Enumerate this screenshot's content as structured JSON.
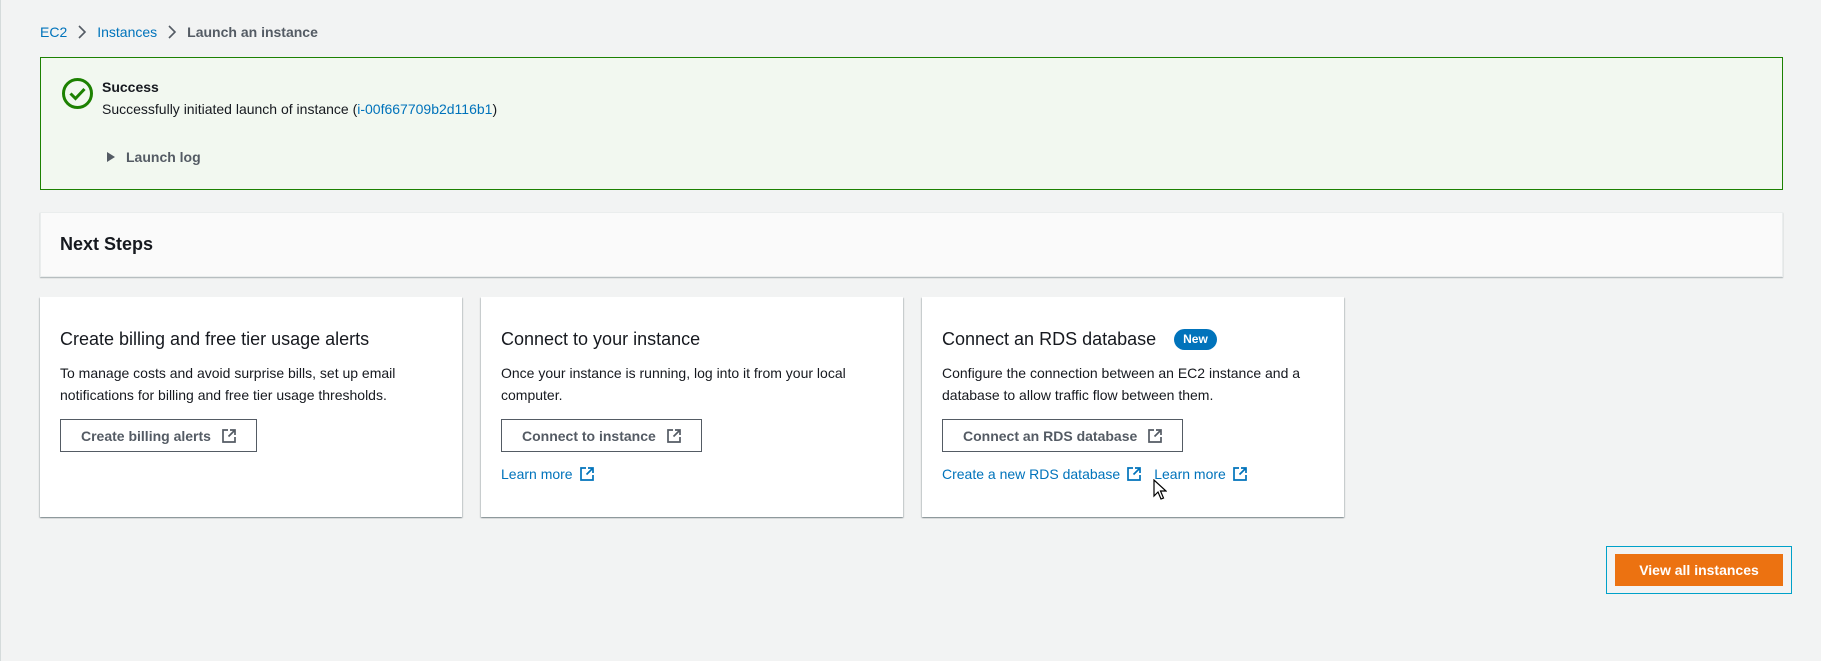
{
  "breadcrumb": {
    "items": [
      "EC2",
      "Instances"
    ],
    "current": "Launch an instance"
  },
  "flash": {
    "title": "Success",
    "message_prefix": "Successfully initiated launch of instance (",
    "instance_id": "i-00f667709b2d116b1",
    "message_suffix": ")",
    "launch_log_label": "Launch log",
    "status_color": "#1d8102"
  },
  "next_steps": {
    "title": "Next Steps"
  },
  "cards": {
    "billing": {
      "title": "Create billing and free tier usage alerts",
      "description": "To manage costs and avoid surprise bills, set up email notifications for billing and free tier usage thresholds.",
      "button_label": "Create billing alerts"
    },
    "connect": {
      "title": "Connect to your instance",
      "description": "Once your instance is running, log into it from your local computer.",
      "button_label": "Connect to instance",
      "link_label": "Learn more"
    },
    "rds": {
      "title": "Connect an RDS database",
      "badge": "New",
      "description": "Configure the connection between an EC2 instance and a database to allow traffic flow between them.",
      "button_label": "Connect an RDS database",
      "link1_label": "Create a new RDS database",
      "link2_label": "Learn more"
    }
  },
  "primary_button": {
    "label": "View all instances",
    "color": "#ec7211"
  },
  "icons": {
    "external": "external-link-icon",
    "success": "check-circle-icon",
    "caret": "caret-right-icon",
    "chevron": "chevron-right-icon"
  }
}
